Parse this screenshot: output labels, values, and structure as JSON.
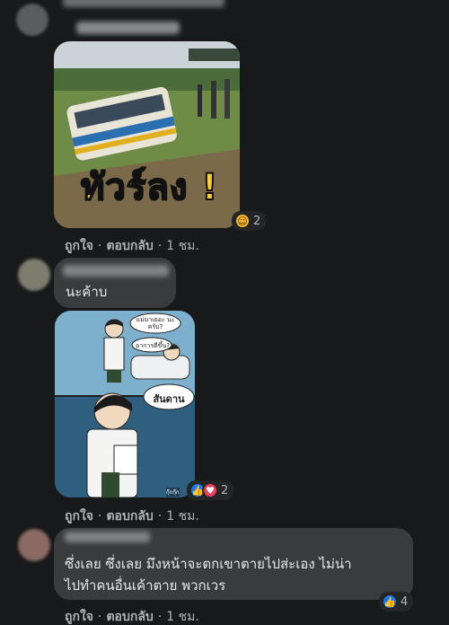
{
  "comments": [
    {
      "actions": {
        "like": "ถูกใจ",
        "reply": "ตอบกลับ",
        "time": "1 ชม."
      },
      "image_caption": "ทัวร์ลง !",
      "reaction_count": "2"
    },
    {
      "text": "นะค้าบ",
      "actions": {
        "like": "ถูกใจ",
        "reply": "ตอบกลับ",
        "time": "1 ชม."
      },
      "comic": {
        "bubble1": "แม่มาเยอะ นะครับ?",
        "bubble2": "อาการดีขึ้น?",
        "bubble3": "สันดาน",
        "tag": "กุ๊กกุ๊ก"
      },
      "reaction_count": "2"
    },
    {
      "text_line1": "ซึ่งเลย ซึ่งเลย มึงหน้าจะตกเขาตายไปส่ะเอง ไม่น่า",
      "text_line2": "ไปทำคนอื่นเค้าตาย พวกเวร",
      "actions": {
        "like": "ถูกใจ",
        "reply": "ตอบกลับ",
        "time": "1 ชม."
      },
      "reaction_count": "4"
    }
  ],
  "colors": {
    "background": "#18191a",
    "bubble": "#3a3b3c",
    "like": "#1877f2",
    "love": "#f33e58",
    "caption": "#ffd11a"
  },
  "icons": [
    "like-icon",
    "love-icon",
    "haha-icon"
  ]
}
